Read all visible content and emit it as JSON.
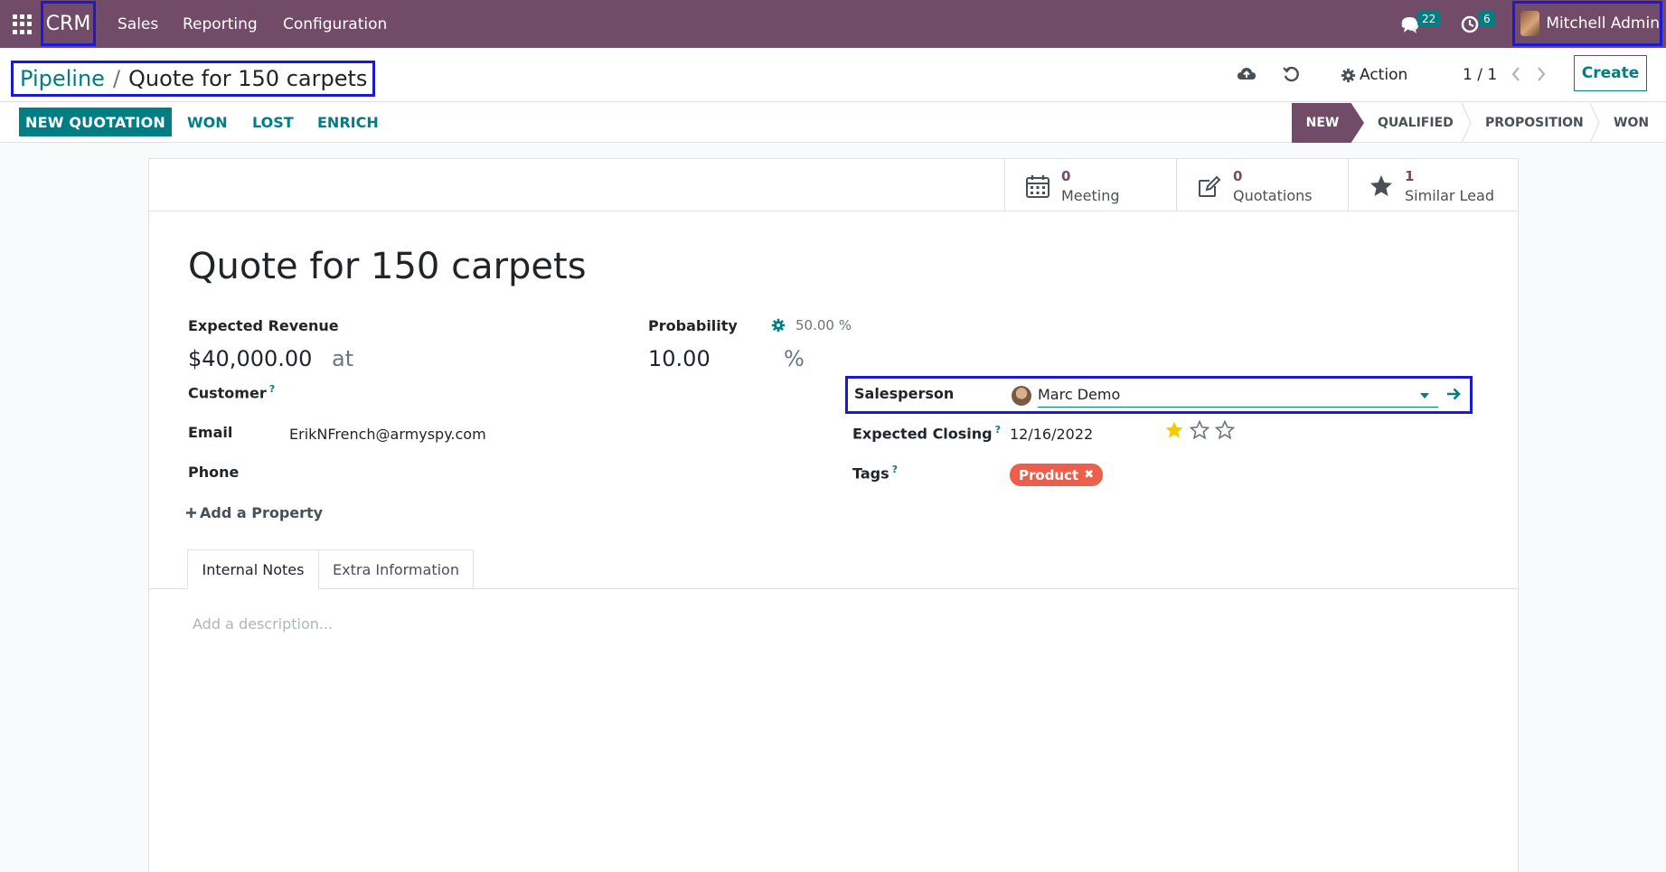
{
  "navbar": {
    "brand": "CRM",
    "menu": [
      "Sales",
      "Reporting",
      "Configuration"
    ],
    "messages_count": "22",
    "activities_count": "6",
    "user_name": "Mitchell Admin",
    "icons": [
      "apps-icon",
      "chat-icon",
      "clock-icon"
    ]
  },
  "breadcrumb": {
    "parent": "Pipeline",
    "separator": "/",
    "current": "Quote for 150 carpets"
  },
  "control": {
    "action_label": "Action",
    "pager": "1 / 1",
    "create_label": "Create",
    "icons": [
      "cloud-upload-icon",
      "discard-icon",
      "gear-icon",
      "chevron-left-icon",
      "chevron-right-icon"
    ]
  },
  "statusbar": {
    "new_quotation": "NEW QUOTATION",
    "won": "WON",
    "lost": "LOST",
    "enrich": "ENRICH",
    "stages": [
      "NEW",
      "QUALIFIED",
      "PROPOSITION",
      "WON"
    ],
    "active_stage": "NEW"
  },
  "smart_buttons": [
    {
      "count": "0",
      "label": "Meeting",
      "icon": "calendar-icon"
    },
    {
      "count": "0",
      "label": "Quotations",
      "icon": "edit-icon"
    },
    {
      "count": "1",
      "label": "Similar Lead",
      "icon": "star-icon"
    }
  ],
  "form": {
    "title": "Quote for 150 carpets",
    "expected_revenue_label": "Expected Revenue",
    "expected_revenue": "$40,000.00",
    "at": "at",
    "probability_label": "Probability",
    "probability_auto": "50.00 %",
    "probability": "10.00",
    "percent": "%",
    "customer_label": "Customer",
    "help": "?",
    "email_label": "Email",
    "email": "ErikNFrench@armyspy.com",
    "phone_label": "Phone",
    "salesperson_label": "Salesperson",
    "salesperson": "Marc Demo",
    "expected_closing_label": "Expected Closing",
    "expected_closing": "12/16/2022",
    "priority_stars": 1,
    "priority_max": 3,
    "tags_label": "Tags",
    "tag": "Product",
    "add_property": "Add a Property",
    "accent_color": "#714b67",
    "link_color": "#017e84",
    "tag_color": "#ee5e4b",
    "star_color": "#f3cc00"
  },
  "tabs": [
    "Internal Notes",
    "Extra Information"
  ],
  "notes_placeholder": "Add a description..."
}
